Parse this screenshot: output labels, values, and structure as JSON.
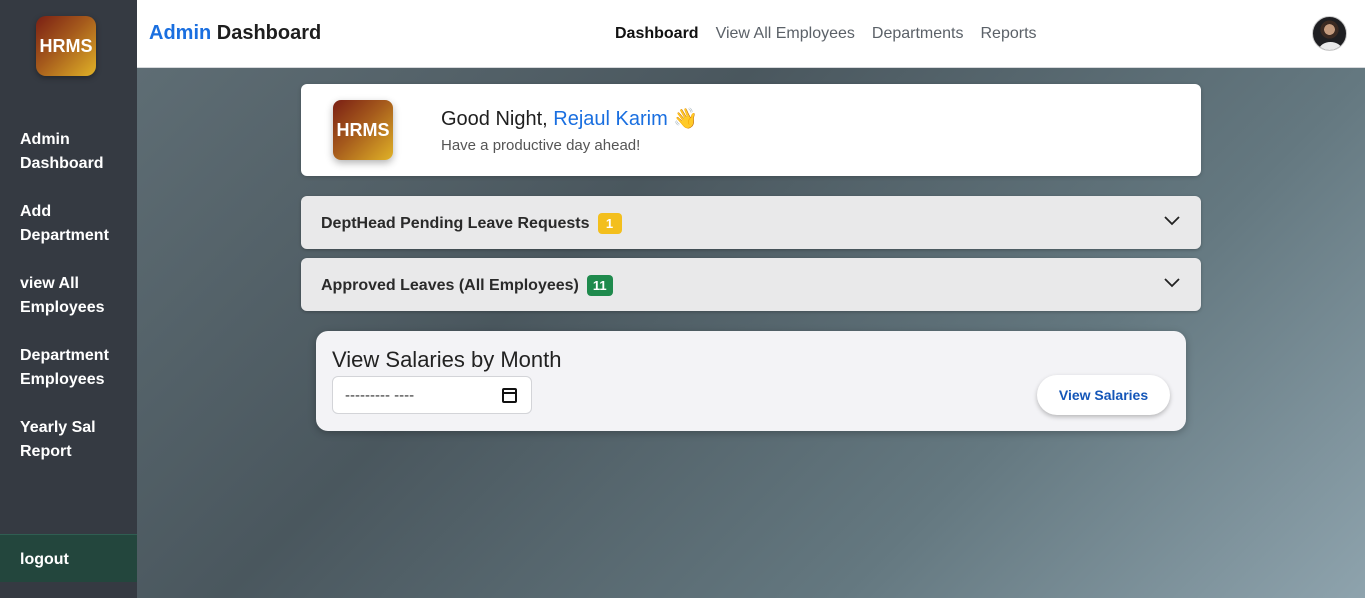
{
  "sidebar": {
    "logo_text": "HRMS",
    "items": [
      {
        "label": "Admin Dashboard"
      },
      {
        "label": "Add Department"
      },
      {
        "label": "view All Employees"
      },
      {
        "label": "Department Employees"
      },
      {
        "label": "Yearly Sal Report"
      }
    ],
    "logout_label": "logout"
  },
  "header": {
    "brand_accent": "Admin",
    "brand_rest": " Dashboard",
    "nav": [
      {
        "label": "Dashboard",
        "active": true
      },
      {
        "label": "View All Employees"
      },
      {
        "label": "Departments"
      },
      {
        "label": "Reports"
      }
    ]
  },
  "greeting": {
    "logo_text": "HRMS",
    "prefix": "Good Night, ",
    "name": "Rejaul Karim",
    "emoji": "👋",
    "subtitle": "Have a productive day ahead!"
  },
  "accordions": [
    {
      "label": "DeptHead Pending Leave Requests",
      "count": "1",
      "badge_color": "#f3bf1d"
    },
    {
      "label": "Approved Leaves (All Employees)",
      "count": "11",
      "badge_color": "#1f8a4d"
    }
  ],
  "salary": {
    "title": "View Salaries by Month",
    "month_value": "--------- ----",
    "button_label": "View Salaries"
  },
  "colors": {
    "accent": "#1a6fe0",
    "sidebar": "#353a42",
    "logout": "#23463d"
  },
  "icons": {
    "calendar": "calendar-icon",
    "chevron": "chevron-down-icon",
    "avatar": "user-avatar"
  }
}
